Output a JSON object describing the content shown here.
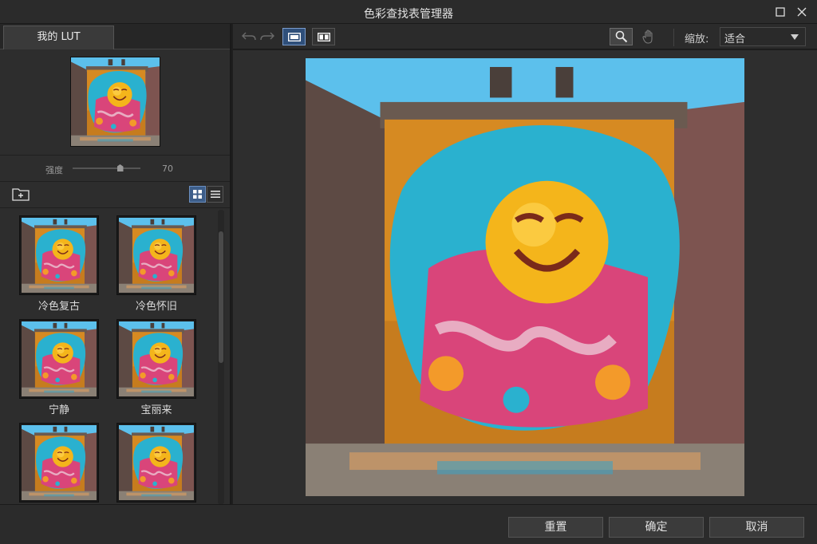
{
  "window": {
    "title": "色彩查找表管理器",
    "controls": [
      "maximize-icon",
      "close-icon"
    ]
  },
  "left_panel": {
    "tab_label": "我的 LUT",
    "strength": {
      "label": "强度",
      "value": "70",
      "fraction": 0.7
    },
    "view_modes": {
      "selected": "grid",
      "options": [
        "grid",
        "list"
      ]
    },
    "luts": [
      {
        "name": "冷色复古"
      },
      {
        "name": "冷色怀旧"
      },
      {
        "name": "宁静"
      },
      {
        "name": "宝丽来"
      },
      {
        "name": ""
      },
      {
        "name": ""
      }
    ]
  },
  "toolbar": {
    "undo_icon": "undo-icon",
    "redo_icon": "redo-icon",
    "compare_modes": [
      "single-view",
      "split-view"
    ],
    "selected_compare": "single-view",
    "tools": [
      "zoom-tool",
      "hand-tool"
    ],
    "selected_tool": "zoom-tool",
    "zoom_label": "缩放:",
    "zoom_value": "适合"
  },
  "footer": {
    "reset_label": "重置",
    "ok_label": "确定",
    "cancel_label": "取消"
  },
  "colors": {
    "accent": "#3d5e8a",
    "background": "#2d2d2d"
  }
}
